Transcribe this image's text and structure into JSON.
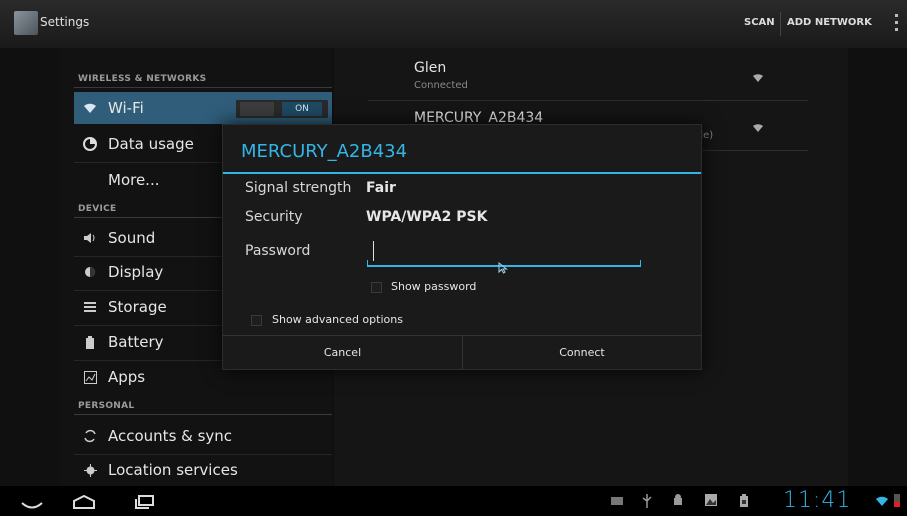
{
  "actionbar": {
    "title": "Settings",
    "scan_label": "SCAN",
    "add_network_label": "ADD NETWORK"
  },
  "sidebar": {
    "wireless_header": "WIRELESS & NETWORKS",
    "device_header": "DEVICE",
    "personal_header": "PERSONAL",
    "wifi": {
      "label": "Wi-Fi",
      "toggle_state": "ON"
    },
    "data_usage": "Data usage",
    "more": "More...",
    "sound": "Sound",
    "display": "Display",
    "storage": "Storage",
    "battery": "Battery",
    "apps": "Apps",
    "accounts_sync": "Accounts & sync",
    "location_services": "Location services"
  },
  "networks": [
    {
      "name": "Glen",
      "status": "Connected"
    },
    {
      "name": "MERCURY_A2B434",
      "status_tail": "ble)"
    }
  ],
  "dialog": {
    "title": "MERCURY_A2B434",
    "signal_label": "Signal strength",
    "signal_value": "Fair",
    "security_label": "Security",
    "security_value": "WPA/WPA2 PSK",
    "password_label": "Password",
    "password_value": "",
    "show_password_label": "Show password",
    "show_advanced_label": "Show advanced options",
    "cancel_label": "Cancel",
    "connect_label": "Connect"
  },
  "statusbar": {
    "clock": "11:41"
  },
  "colors": {
    "accent": "#33b5e5",
    "selected_item": "#2f5d7a"
  }
}
